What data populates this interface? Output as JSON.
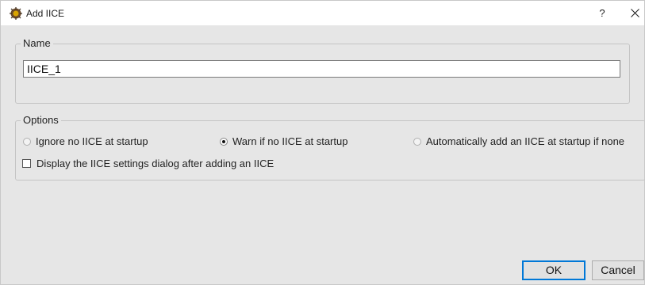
{
  "window": {
    "title": "Add IICE",
    "icon": "gear-chip-icon",
    "help_label": "?",
    "close_icon": "close-icon"
  },
  "name_group": {
    "legend": "Name",
    "value": "IICE_1"
  },
  "options_group": {
    "legend": "Options",
    "radios": [
      {
        "label": "Ignore no IICE at startup",
        "checked": false
      },
      {
        "label": "Warn if no IICE at startup",
        "checked": true
      },
      {
        "label": "Automatically add an IICE at startup if none",
        "checked": false
      }
    ],
    "checkbox": {
      "label": "Display the IICE settings dialog after adding an IICE",
      "checked": false
    }
  },
  "buttons": {
    "ok": "OK",
    "cancel": "Cancel"
  },
  "colors": {
    "accent": "#0078d7",
    "background": "#e6e6e6"
  }
}
